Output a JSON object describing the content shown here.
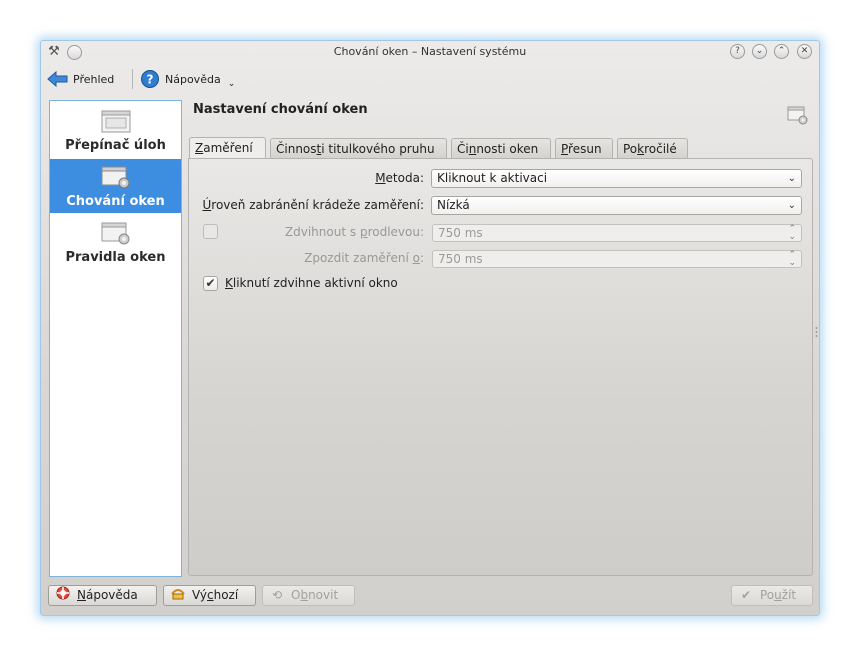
{
  "window": {
    "title": "Chování oken – Nastavení systému",
    "controls": [
      "?",
      "⌄",
      "⌃",
      "✕"
    ]
  },
  "toolbar": {
    "overview_label": "Přehled",
    "help_label": "Nápověda"
  },
  "sidebar": {
    "items": [
      {
        "label": "Přepínač úloh",
        "active": false
      },
      {
        "label": "Chování oken",
        "active": true
      },
      {
        "label": "Pravidla oken",
        "active": false
      }
    ]
  },
  "main": {
    "title": "Nastavení chování oken",
    "tabs": [
      {
        "pre": "",
        "key": "Z",
        "post": "aměření",
        "active": true
      },
      {
        "pre": "Činnos",
        "key": "t",
        "post": "i titulkového pruhu",
        "active": false
      },
      {
        "pre": "Či",
        "key": "n",
        "post": "nosti oken",
        "active": false
      },
      {
        "pre": "",
        "key": "P",
        "post": "řesun",
        "active": false
      },
      {
        "pre": "Po",
        "key": "k",
        "post": "ročilé",
        "active": false
      }
    ],
    "focus": {
      "method_label_key": "M",
      "method_label_rest": "etoda:",
      "method_value": "Kliknout k aktivaci",
      "steal_label_key": "Ú",
      "steal_label_rest": "roveň zabránění krádeže zaměření:",
      "steal_value": "Nízká",
      "raise_delay_label_pre": "Zdvihnout s ",
      "raise_delay_label_key": "p",
      "raise_delay_label_post": "rodlevou:",
      "raise_delay_value": "750 ms",
      "raise_delay_checked": false,
      "delay_focus_label_pre": "Zpozdit zaměření ",
      "delay_focus_label_key": "o",
      "delay_focus_label_post": ":",
      "delay_focus_value": "750 ms",
      "click_raise_label_key": "K",
      "click_raise_label_rest": "liknutí zdvihne aktivní okno",
      "click_raise_checked": true
    }
  },
  "buttons": {
    "help": {
      "key": "N",
      "rest": "ápověda"
    },
    "defaults": {
      "pre": "Vý",
      "key": "c",
      "post": "hozí"
    },
    "reset": {
      "pre": "O",
      "key": "b",
      "post": "novit"
    },
    "apply": {
      "pre": "Po",
      "key": "u",
      "post": "žít"
    }
  },
  "colors": {
    "selection": "#3d8ee0",
    "window_glow": "#5aaae6"
  }
}
